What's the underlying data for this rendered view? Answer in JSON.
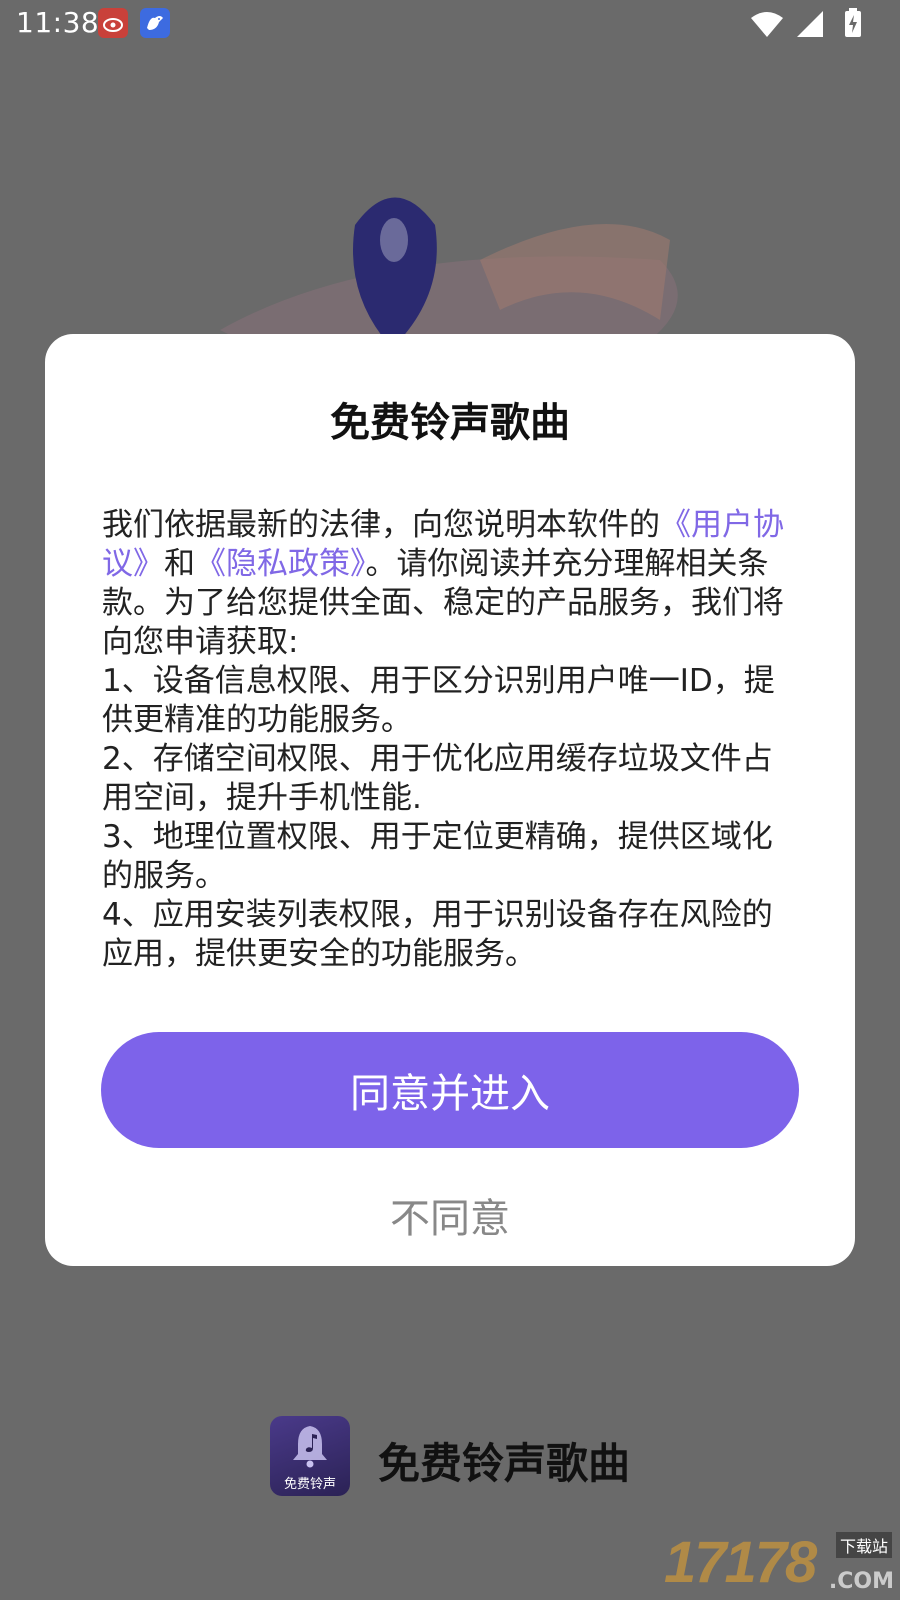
{
  "status_bar": {
    "time": "11:38",
    "icons": [
      "weibo-app-icon",
      "pigeon-app-icon",
      "wifi-icon",
      "cell-signal-icon",
      "battery-charging-icon"
    ]
  },
  "dialog": {
    "title": "免费铃声歌曲",
    "intro_prefix": "我们依据最新的法律，向您说明本软件的",
    "link_user_agreement": "《用户协议》",
    "intro_and": "和",
    "link_privacy": "《隐私政策》",
    "intro_suffix": "。请你阅读并充分理解相关条款。为了给您提供全面、稳定的产品服务，我们将向您申请获取:",
    "items": [
      "1、设备信息权限、用于区分识别用户唯一ID，提供更精准的功能服务。",
      "2、存储空间权限、用于优化应用缓存垃圾文件占用空间，提升手机性能.",
      "3、地理位置权限、用于定位更精确，提供区域化的服务。",
      "4、应用安装列表权限，用于识别设备存在风险的应用，提供更安全的功能服务。"
    ],
    "agree_label": "同意并进入",
    "disagree_label": "不同意"
  },
  "footer": {
    "app_name": "免费铃声歌曲",
    "logo_text": "免费铃声"
  },
  "watermark": {
    "number": "17178",
    "tag": "下载站",
    "suffix": ".COM"
  },
  "colors": {
    "accent": "#7d63ea",
    "link": "#8068e6",
    "overlay": "#6a6a6a"
  }
}
